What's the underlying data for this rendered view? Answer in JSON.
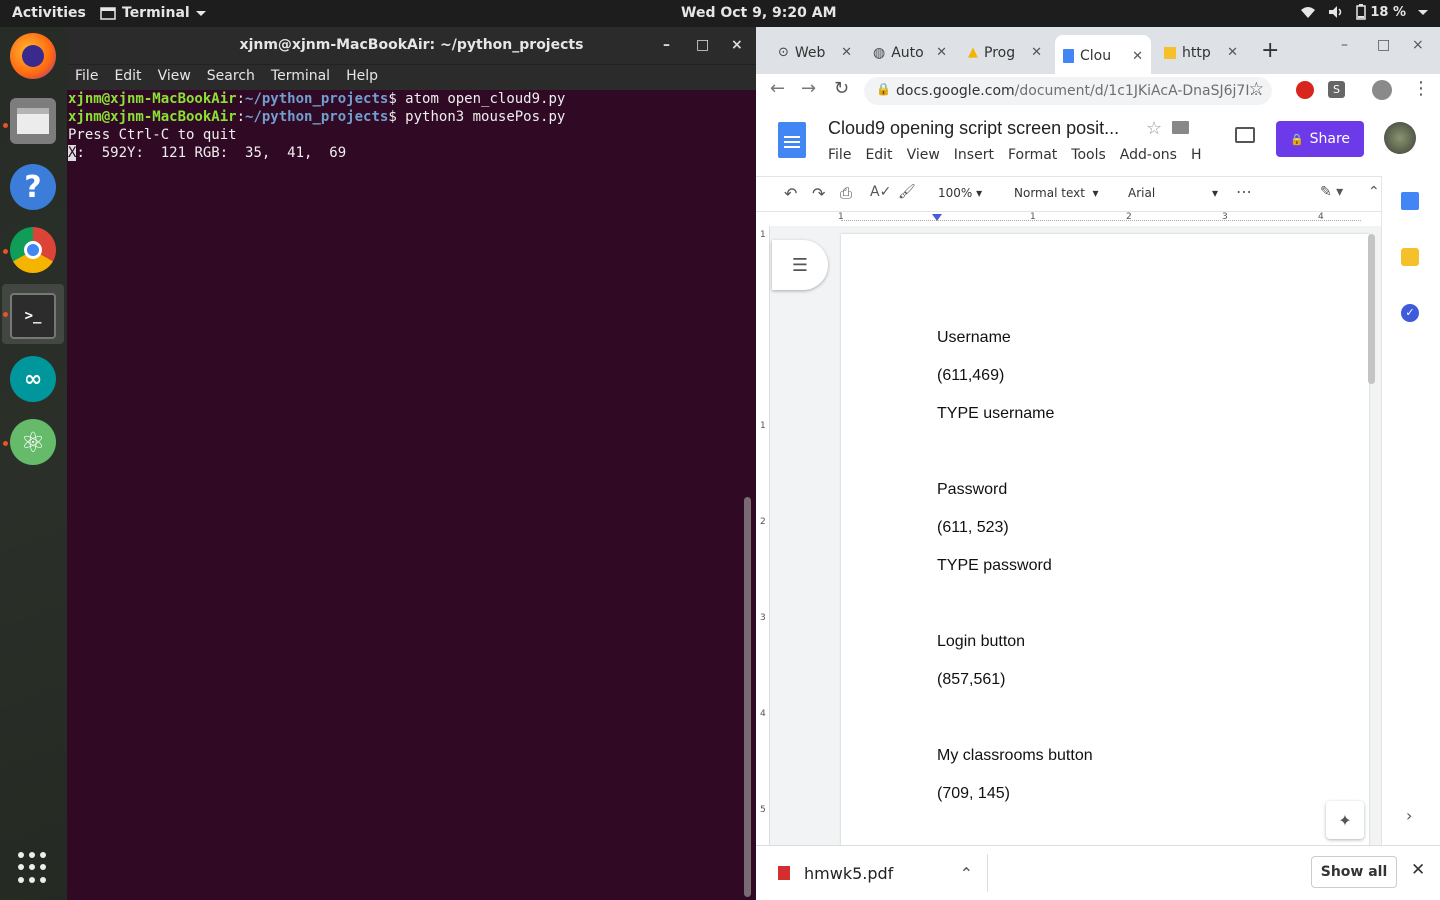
{
  "topbar": {
    "activities": "Activities",
    "app": "Terminal",
    "clock": "Wed Oct  9,  9:20 AM",
    "battery": "18 %"
  },
  "dock": {
    "items": [
      "firefox-icon",
      "files-icon",
      "help-icon",
      "chrome-icon",
      "terminal-icon",
      "arduino-icon",
      "atom-icon",
      "app-grid-icon"
    ]
  },
  "terminal": {
    "title": "xjnm@xjnm-MacBookAir: ~/python_projects",
    "menu": [
      "File",
      "Edit",
      "View",
      "Search",
      "Terminal",
      "Help"
    ],
    "lines": [
      {
        "user": "xjnm@xjnm-MacBookAir",
        "path": "~/python_projects",
        "cmd": "atom open_cloud9.py"
      },
      {
        "user": "xjnm@xjnm-MacBookAir",
        "path": "~/python_projects",
        "cmd": "python3 mousePos.py"
      }
    ],
    "output1": "Press Ctrl-C to quit",
    "output2_cursor": "X",
    "output2_rest": ":  592Y:  121 RGB:  35,  41,  69"
  },
  "chrome": {
    "tabs": [
      {
        "label": "Web",
        "icon": "web-icon"
      },
      {
        "label": "Auto",
        "icon": "globe-icon"
      },
      {
        "label": "Prog",
        "icon": "drive-icon"
      },
      {
        "label": "Clou",
        "icon": "docs-icon"
      },
      {
        "label": "http",
        "icon": "box-icon"
      }
    ],
    "url_host": "docs.google.com",
    "url_path": "/document/d/1c1JKiAcA-DnaSJ6j7I..."
  },
  "docs": {
    "title": "Cloud9 opening script screen posit...",
    "menu": [
      "File",
      "Edit",
      "View",
      "Insert",
      "Format",
      "Tools",
      "Add-ons",
      "Help"
    ],
    "share": "Share",
    "zoom": "100%",
    "style": "Normal text",
    "font": "Arial",
    "ruler": [
      "1",
      "1",
      "2",
      "3",
      "4"
    ],
    "vruler": [
      "1",
      "1",
      "2",
      "3",
      "4",
      "5"
    ],
    "lines": [
      "Username",
      "(611,469)",
      "TYPE username",
      "Password",
      "(611, 523)",
      "TYPE password",
      "Login button",
      "(857,561)",
      "My classrooms button",
      "(709, 145)"
    ]
  },
  "downloads": {
    "file": "hmwk5.pdf",
    "show_all": "Show all"
  }
}
